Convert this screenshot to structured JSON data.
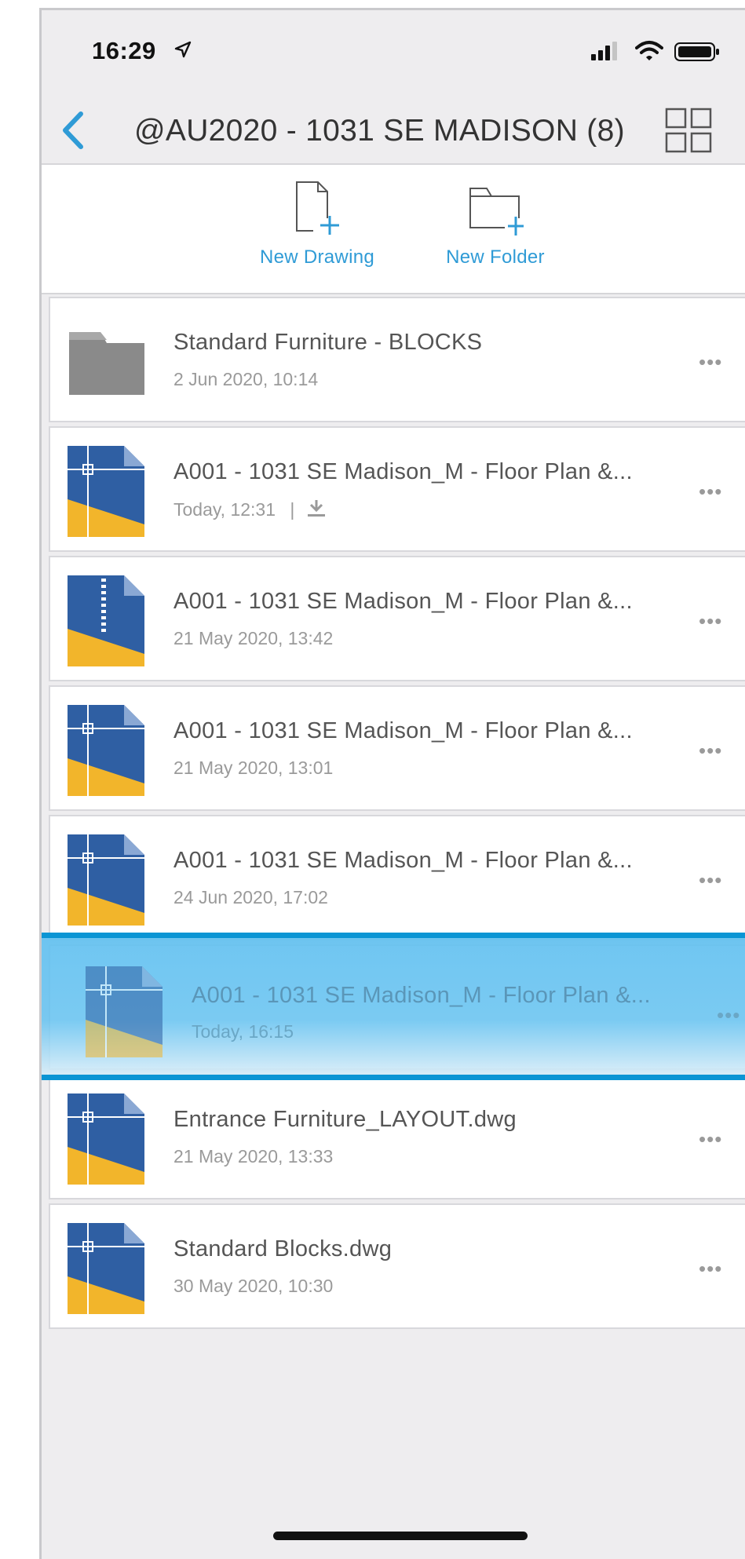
{
  "status_bar": {
    "time": "16:29",
    "icons": [
      "location-arrow-icon",
      "signal-icon",
      "wifi-icon",
      "battery-icon"
    ]
  },
  "nav": {
    "title": "@AU2020 - 1031 SE MADISON (8)",
    "icons": [
      "chevron-left-icon",
      "grid-view-icon"
    ],
    "accent": "#2f9bd6"
  },
  "actions": {
    "new_drawing": "New Drawing",
    "new_folder": "New Folder"
  },
  "files": [
    {
      "name": "Standard Furniture - BLOCKS",
      "date": "2 Jun 2020, 10:14",
      "kind": "folder"
    },
    {
      "name": "A001 - 1031 SE Madison_M - Floor Plan &...",
      "date": "Today, 12:31",
      "separator": "|",
      "kind": "dwg",
      "downloaded": true
    },
    {
      "name": "A001 - 1031 SE Madison_M - Floor Plan &...",
      "date": "21 May 2020, 13:42",
      "kind": "dwg-zip"
    },
    {
      "name": "A001 - 1031 SE Madison_M - Floor Plan &...",
      "date": "21 May 2020, 13:01",
      "kind": "dwg"
    },
    {
      "name": "A001 - 1031 SE Madison_M - Floor Plan &...",
      "date": "24 Jun 2020, 17:02",
      "kind": "dwg"
    },
    {
      "name": "Entrance Furniture_LAYOUT.dwg",
      "date": "21 May 2020, 13:33",
      "kind": "dwg"
    },
    {
      "name": "Standard Blocks.dwg",
      "date": "30 May 2020, 10:30",
      "kind": "dwg"
    }
  ],
  "dragging": {
    "name": "A001 - 1031 SE Madison_M - Floor Plan &...",
    "date": "Today, 16:15",
    "kind": "dwg"
  },
  "more_label": "•••",
  "colors": {
    "dwg_blue": "#2f5fa3",
    "dwg_yellow": "#f2b52b",
    "folder_gray": "#8a8a8a",
    "selection_border": "#0b95d4"
  }
}
